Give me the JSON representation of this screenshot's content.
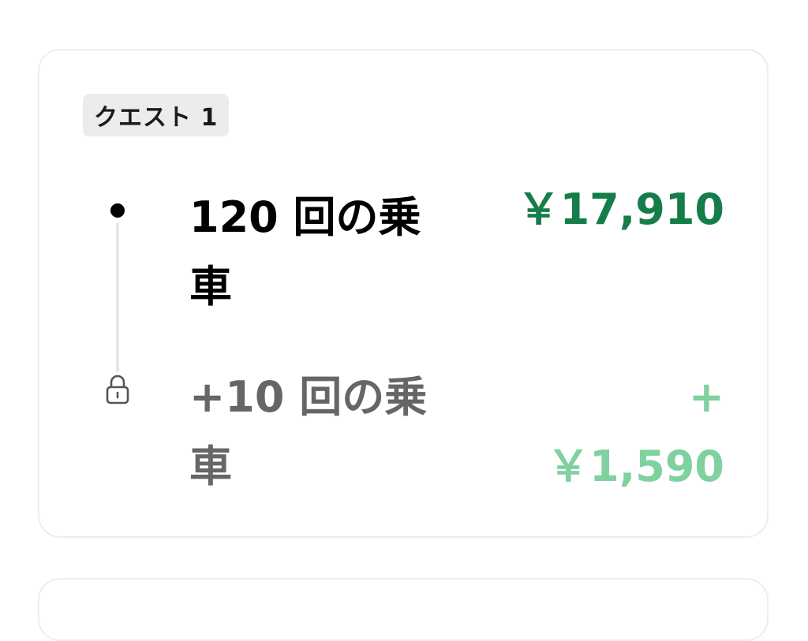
{
  "quest": {
    "badge_label": "クエスト 1",
    "steps": [
      {
        "title": "120 回の乗車",
        "amount": "￥17,910",
        "state": "active"
      },
      {
        "title": "+10 回の乗車",
        "amount": "+ ￥1,590",
        "state": "locked"
      }
    ]
  },
  "colors": {
    "active_amount": "#157d4a",
    "locked_amount": "#7fd19f",
    "locked_title": "#666666",
    "badge_bg": "#ececec",
    "card_border": "#ededed"
  },
  "icons": {
    "timeline_active": "dot-icon",
    "timeline_locked": "lock-icon"
  }
}
